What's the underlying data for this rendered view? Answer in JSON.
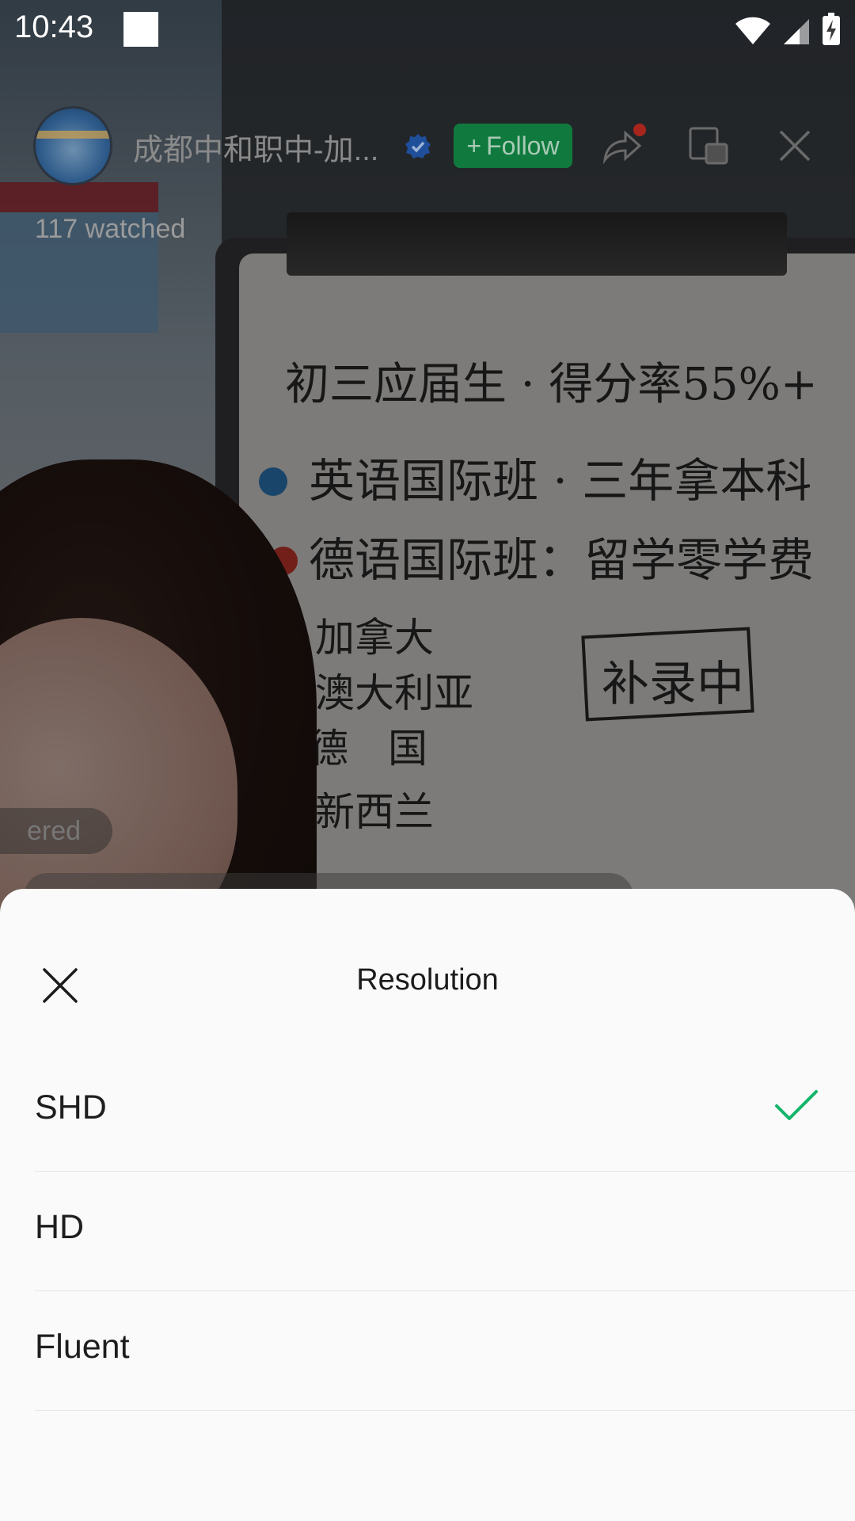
{
  "status_bar": {
    "time": "10:43"
  },
  "live": {
    "channel_name": "成都中和职中-加...",
    "follow_label": "Follow",
    "watched_text": "117 watched",
    "comment_fragment": "ered"
  },
  "board": {
    "line1": "初三应届生 · 得分率55%+",
    "line2": "英语国际班 · 三年拿本科",
    "line3": "德语国际班：留学零学费",
    "line4": "加拿大",
    "line5": "澳大利亚",
    "line6": "德　国",
    "line7": "新西兰",
    "stamp": "补录中"
  },
  "sheet": {
    "title": "Resolution",
    "options": [
      {
        "label": "SHD",
        "selected": true
      },
      {
        "label": "HD",
        "selected": false
      },
      {
        "label": "Fluent",
        "selected": false
      }
    ]
  },
  "colors": {
    "accent_check": "#14b56a",
    "follow_bg": "#107a3e",
    "verified": "#1f6fe0"
  }
}
